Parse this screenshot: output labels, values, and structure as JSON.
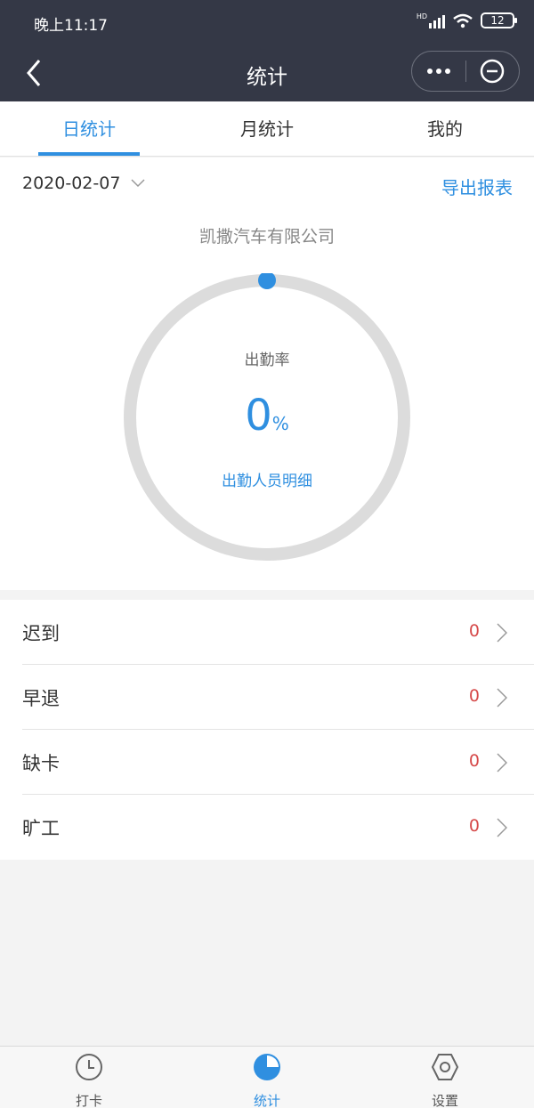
{
  "status_bar": {
    "time": "晚上11:17",
    "signal_label": "HD",
    "battery": "12"
  },
  "nav": {
    "title": "统计",
    "back_icon": "back-arrow-icon",
    "more_icon": "more-dots-icon",
    "close_icon": "minus-circle-icon"
  },
  "tabs": [
    {
      "label": "日统计",
      "active": true
    },
    {
      "label": "月统计",
      "active": false
    },
    {
      "label": "我的",
      "active": false
    }
  ],
  "filters": {
    "date": "2020-02-07",
    "export_label": "导出报表"
  },
  "summary": {
    "company": "凯撒汽车有限公司",
    "rate_label": "出勤率",
    "rate_value": "0",
    "rate_unit": "%",
    "rate_fraction": 0,
    "detail_link": "出勤人员明细"
  },
  "stats": [
    {
      "label": "迟到",
      "count": "0"
    },
    {
      "label": "早退",
      "count": "0"
    },
    {
      "label": "缺卡",
      "count": "0"
    },
    {
      "label": "旷工",
      "count": "0"
    }
  ],
  "bottom_nav": [
    {
      "label": "打卡",
      "icon": "clock-icon",
      "active": false
    },
    {
      "label": "统计",
      "icon": "pie-chart-icon",
      "active": true
    },
    {
      "label": "设置",
      "icon": "settings-hexagon-icon",
      "active": false
    }
  ],
  "colors": {
    "accent": "#2f8fe0",
    "header_bg": "#343846",
    "count_red": "#d64a4a",
    "ring_gray": "#dcdcdc"
  }
}
